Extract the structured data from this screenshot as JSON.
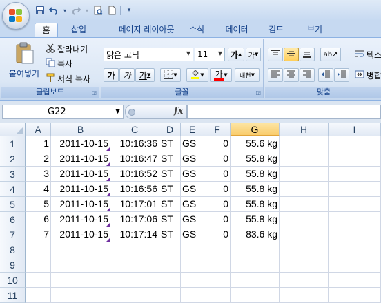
{
  "ribbon_tabs": [
    "홈",
    "삽입",
    "페이지 레이아웃",
    "수식",
    "데이터",
    "검토",
    "보기"
  ],
  "clipboard": {
    "paste_label": "붙여넣기",
    "cut_label": "잘라내기",
    "copy_label": "복사",
    "format_painter_label": "서식 복사",
    "group_label": "클립보드"
  },
  "font": {
    "family": "맑은 고딕",
    "size": "11",
    "grow_label": "가",
    "shrink_label": "가",
    "bold_label": "가",
    "italic_label": "가",
    "underline_label": "가",
    "font_color_label": "가",
    "phonetic_label": "내천",
    "group_label": "글꼴"
  },
  "alignment": {
    "wrap_label": "텍스",
    "merge_label": "병합",
    "group_label": "맞춤"
  },
  "formula_bar": {
    "name_box": "G22",
    "fx_label": "fx",
    "formula": ""
  },
  "columns": [
    "A",
    "B",
    "C",
    "D",
    "E",
    "F",
    "G",
    "H",
    "I"
  ],
  "selected_column": "G",
  "row_numbers": [
    "1",
    "2",
    "3",
    "4",
    "5",
    "6",
    "7",
    "8",
    "9",
    "10",
    "11"
  ],
  "rows": [
    [
      "1",
      "2011-10-15",
      "10:16:36",
      "ST",
      "GS",
      "0",
      "55.6 kg"
    ],
    [
      "2",
      "2011-10-15",
      "10:16:47",
      "ST",
      "GS",
      "0",
      "55.8 kg"
    ],
    [
      "3",
      "2011-10-15",
      "10:16:52",
      "ST",
      "GS",
      "0",
      "55.8 kg"
    ],
    [
      "4",
      "2011-10-15",
      "10:16:56",
      "ST",
      "GS",
      "0",
      "55.8 kg"
    ],
    [
      "5",
      "2011-10-15",
      "10:17:01",
      "ST",
      "GS",
      "0",
      "55.8 kg"
    ],
    [
      "6",
      "2011-10-15",
      "10:17:06",
      "ST",
      "GS",
      "0",
      "55.8 kg"
    ],
    [
      "7",
      "2011-10-15",
      "10:17:14",
      "ST",
      "GS",
      "0",
      "83.6 kg"
    ]
  ],
  "colors": {
    "accent": "#15428b",
    "selected_header": "#f9cc6c",
    "error_indicator": "#7030a0"
  }
}
